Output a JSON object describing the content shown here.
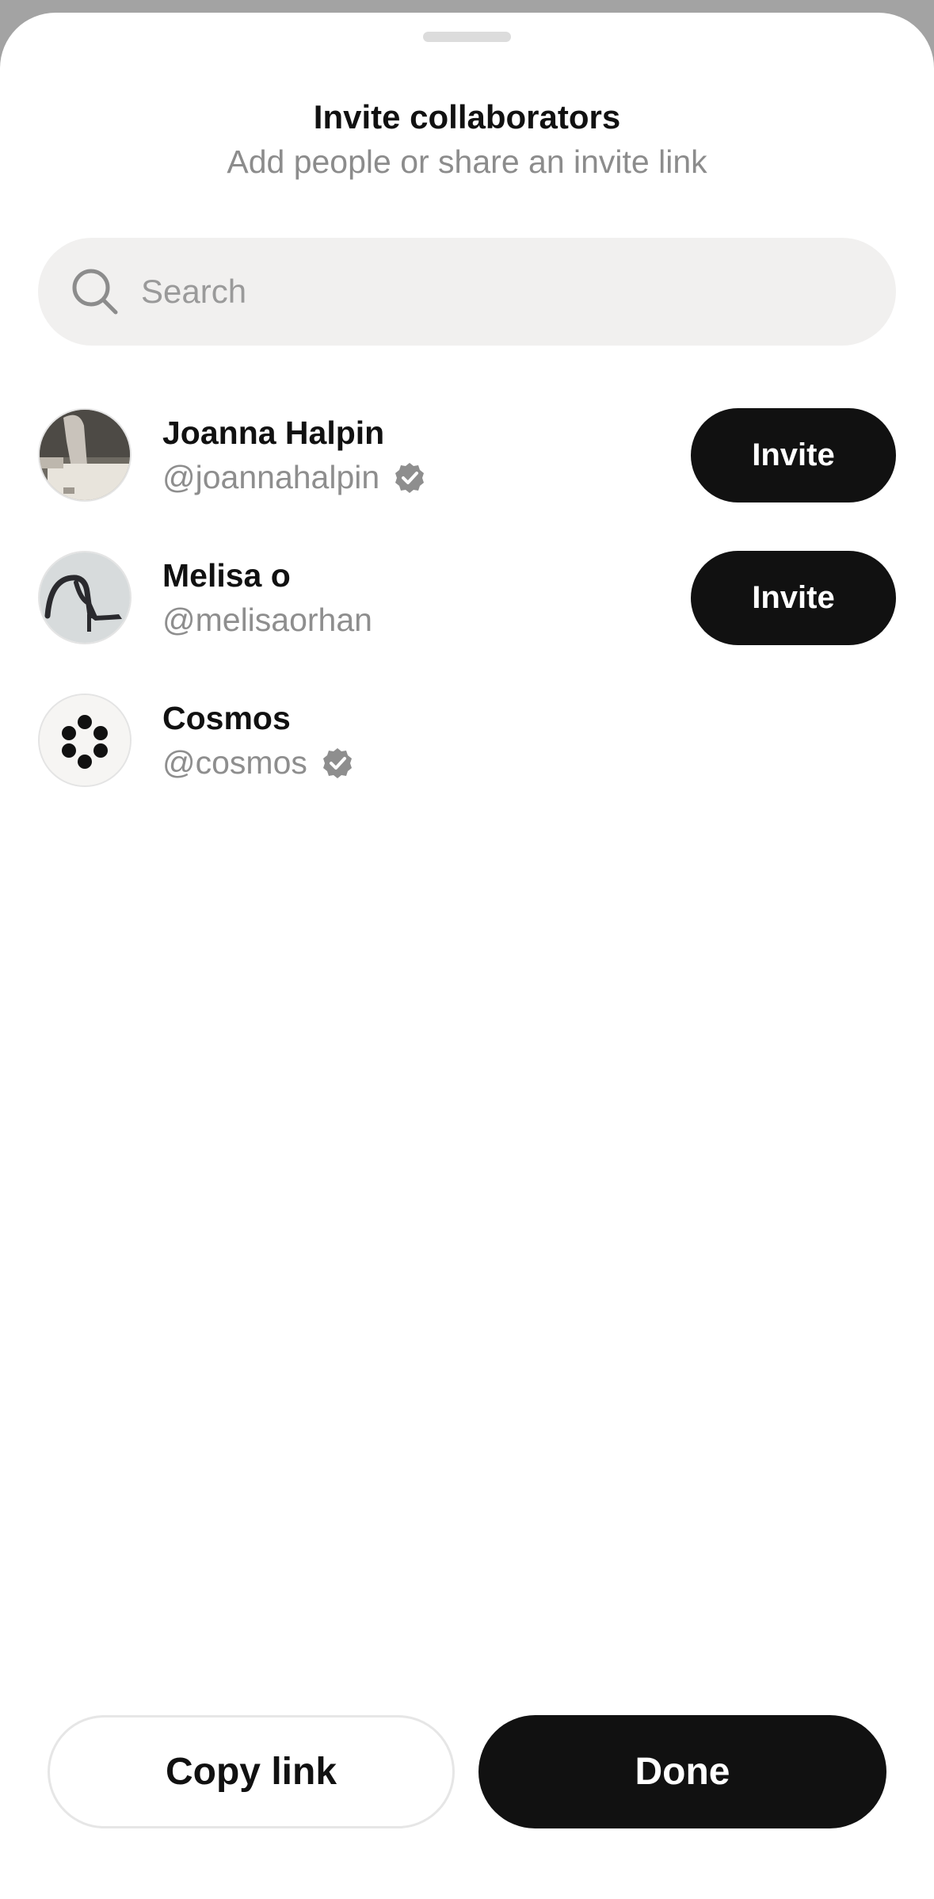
{
  "sheet": {
    "title": "Invite collaborators",
    "subtitle": "Add people or share an invite link"
  },
  "search": {
    "placeholder": "Search",
    "value": "",
    "icon": "search-icon"
  },
  "users": [
    {
      "name": "Joanna Halpin",
      "handle": "@joannahalpin",
      "verified": true,
      "action_label": "Invite",
      "avatar": "photo"
    },
    {
      "name": "Melisa o",
      "handle": "@melisaorhan",
      "verified": false,
      "action_label": "Invite",
      "avatar": "photo"
    },
    {
      "name": "Cosmos",
      "handle": "@cosmos",
      "verified": true,
      "avatar": "cosmos-logo"
    }
  ],
  "footer": {
    "copy_label": "Copy link",
    "done_label": "Done"
  },
  "colors": {
    "primary": "#111111",
    "secondary_text": "#8e8e8e",
    "search_bg": "#f1f0ef",
    "verified_badge": "#8e8e8e"
  }
}
